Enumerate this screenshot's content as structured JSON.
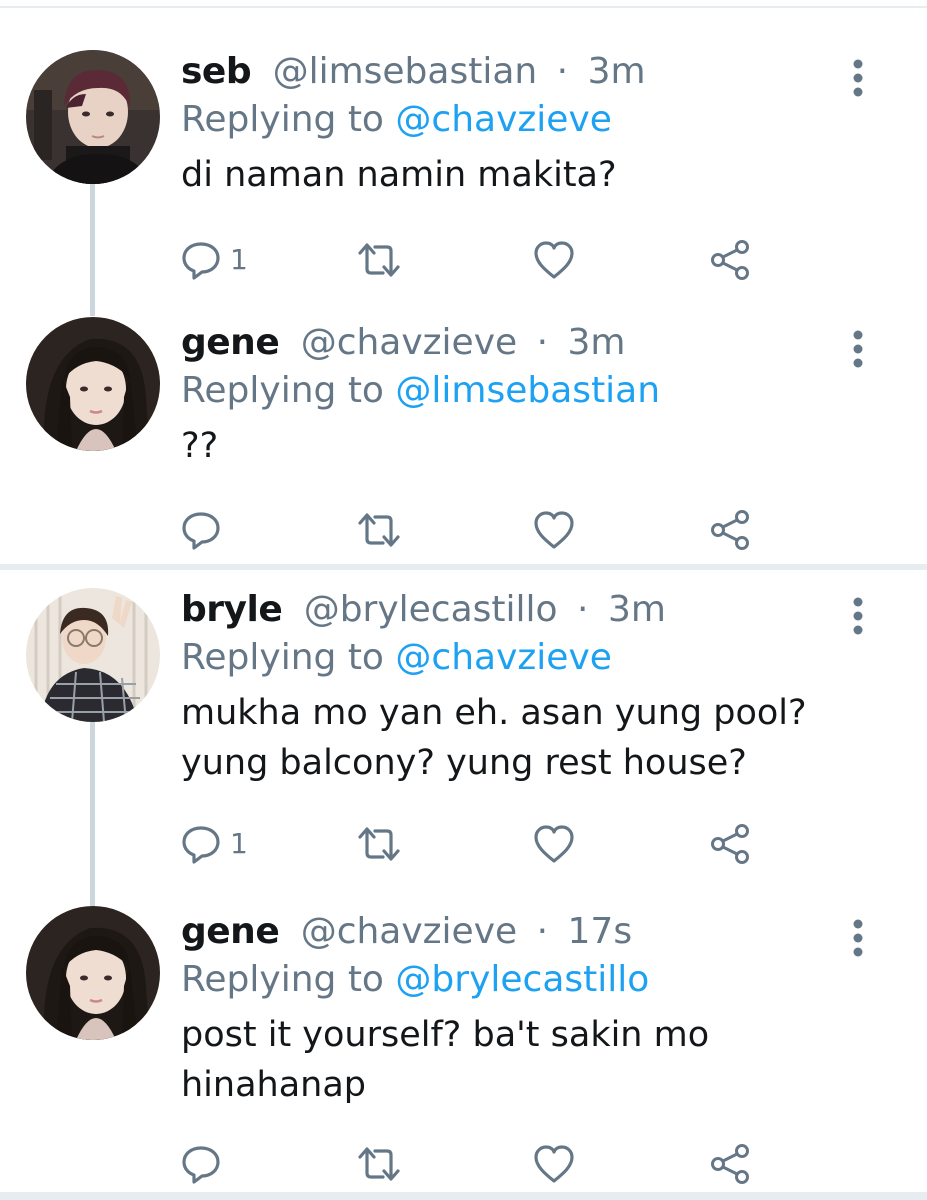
{
  "colors": {
    "text_primary": "#14171a",
    "text_secondary": "#657786",
    "link_blue": "#1da1f2",
    "divider": "#e6ecf0",
    "connector": "#ccd6dd"
  },
  "tweets": [
    {
      "display_name": "seb",
      "handle": "@limsebastian",
      "separator": "·",
      "time": "3m",
      "replying_prefix": "Replying to",
      "replying_to": "@chavzieve",
      "text": "di naman namin makita?",
      "reply_count": "1",
      "icons": [
        "reply-icon",
        "retweet-icon",
        "like-icon",
        "share-icon",
        "more-vertical-icon"
      ]
    },
    {
      "display_name": "gene",
      "handle": "@chavzieve",
      "separator": "·",
      "time": "3m",
      "replying_prefix": "Replying to",
      "replying_to": "@limsebastian",
      "text": "??",
      "reply_count": "",
      "icons": [
        "reply-icon",
        "retweet-icon",
        "like-icon",
        "share-icon",
        "more-vertical-icon"
      ]
    },
    {
      "display_name": "bryle",
      "handle": "@brylecastillo",
      "separator": "·",
      "time": "3m",
      "replying_prefix": "Replying to",
      "replying_to": "@chavzieve",
      "text": "mukha mo yan eh. asan yung pool? yung balcony? yung rest house?",
      "reply_count": "1",
      "icons": [
        "reply-icon",
        "retweet-icon",
        "like-icon",
        "share-icon",
        "more-vertical-icon"
      ]
    },
    {
      "display_name": "gene",
      "handle": "@chavzieve",
      "separator": "·",
      "time": "17s",
      "replying_prefix": "Replying to",
      "replying_to": "@brylecastillo",
      "text": "post it yourself? ba't sakin mo hinahanap",
      "reply_count": "",
      "icons": [
        "reply-icon",
        "retweet-icon",
        "like-icon",
        "share-icon",
        "more-vertical-icon"
      ]
    }
  ]
}
